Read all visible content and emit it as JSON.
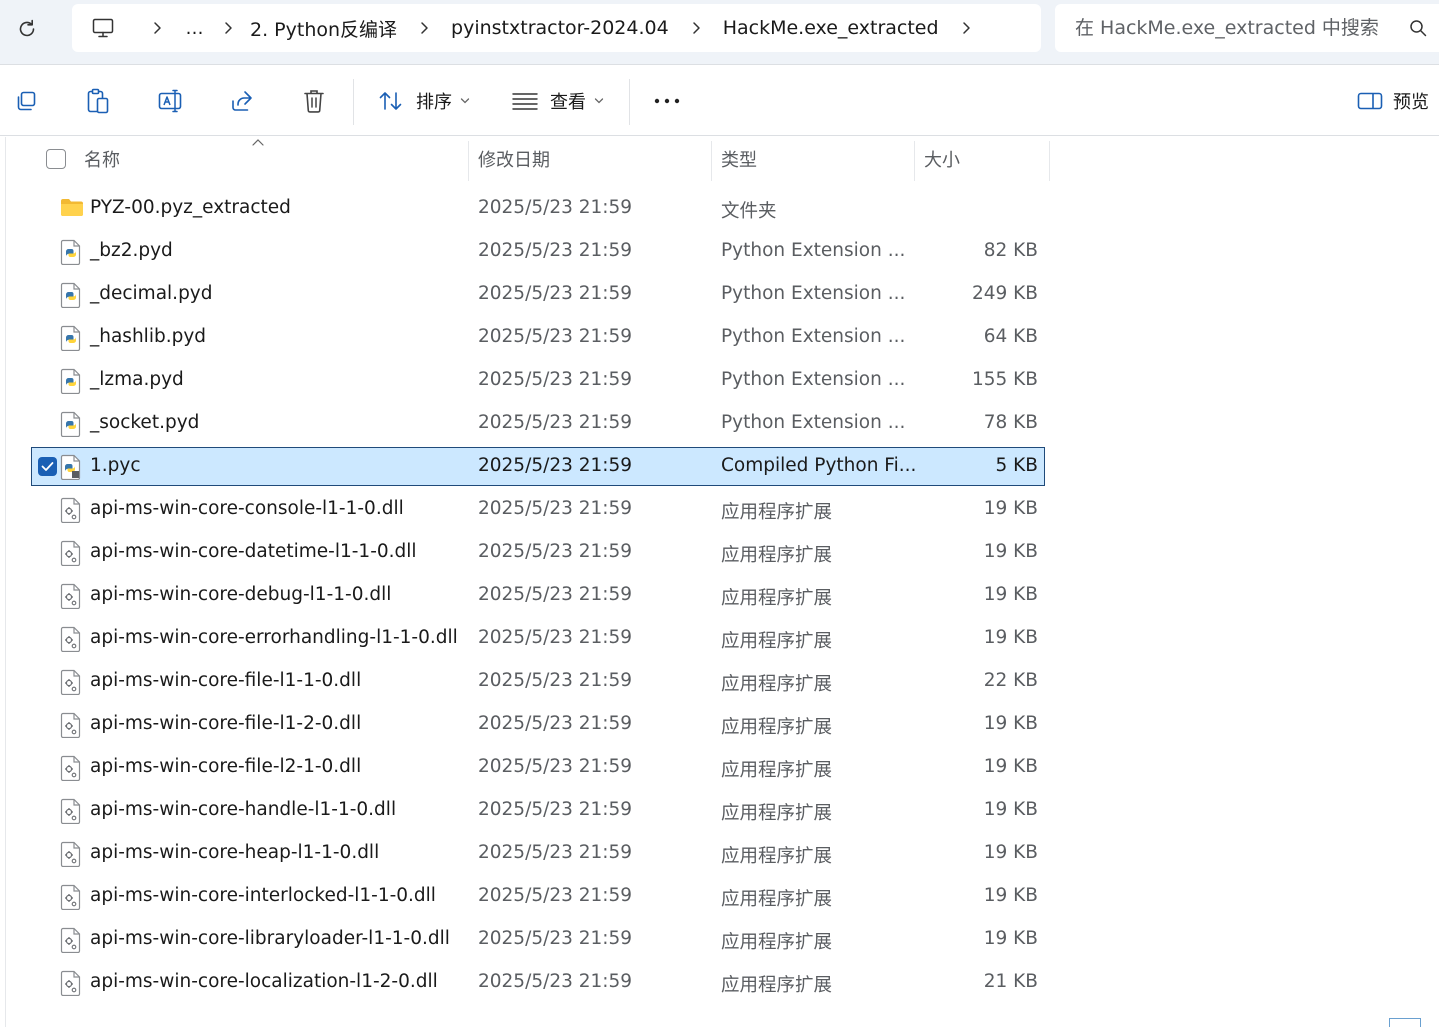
{
  "breadcrumb": {
    "items": [
      "2. Python反编译",
      "pyinstxtractor-2024.04",
      "HackMe.exe_extracted"
    ],
    "overflow": "…"
  },
  "search": {
    "placeholder": "在 HackMe.exe_extracted 中搜索"
  },
  "toolbar": {
    "sort_label": "排序",
    "view_label": "查看",
    "preview_label": "预览"
  },
  "columns": {
    "name": "名称",
    "modified": "修改日期",
    "type": "类型",
    "size": "大小"
  },
  "files": [
    {
      "name": "PYZ-00.pyz_extracted",
      "date": "2025/5/23 21:59",
      "type": "文件夹",
      "size": "",
      "icon": "folder-icon"
    },
    {
      "name": "_bz2.pyd",
      "date": "2025/5/23 21:59",
      "type": "Python Extension ...",
      "size": "82 KB",
      "icon": "python-file-icon"
    },
    {
      "name": "_decimal.pyd",
      "date": "2025/5/23 21:59",
      "type": "Python Extension ...",
      "size": "249 KB",
      "icon": "python-file-icon"
    },
    {
      "name": "_hashlib.pyd",
      "date": "2025/5/23 21:59",
      "type": "Python Extension ...",
      "size": "64 KB",
      "icon": "python-file-icon"
    },
    {
      "name": "_lzma.pyd",
      "date": "2025/5/23 21:59",
      "type": "Python Extension ...",
      "size": "155 KB",
      "icon": "python-file-icon"
    },
    {
      "name": "_socket.pyd",
      "date": "2025/5/23 21:59",
      "type": "Python Extension ...",
      "size": "78 KB",
      "icon": "python-file-icon"
    },
    {
      "name": "1.pyc",
      "date": "2025/5/23 21:59",
      "type": "Compiled Python Fi...",
      "size": "5 KB",
      "icon": "python-compiled-icon",
      "selected": true
    },
    {
      "name": "api-ms-win-core-console-l1-1-0.dll",
      "date": "2025/5/23 21:59",
      "type": "应用程序扩展",
      "size": "19 KB",
      "icon": "dll-file-icon"
    },
    {
      "name": "api-ms-win-core-datetime-l1-1-0.dll",
      "date": "2025/5/23 21:59",
      "type": "应用程序扩展",
      "size": "19 KB",
      "icon": "dll-file-icon"
    },
    {
      "name": "api-ms-win-core-debug-l1-1-0.dll",
      "date": "2025/5/23 21:59",
      "type": "应用程序扩展",
      "size": "19 KB",
      "icon": "dll-file-icon"
    },
    {
      "name": "api-ms-win-core-errorhandling-l1-1-0.dll",
      "date": "2025/5/23 21:59",
      "type": "应用程序扩展",
      "size": "19 KB",
      "icon": "dll-file-icon"
    },
    {
      "name": "api-ms-win-core-file-l1-1-0.dll",
      "date": "2025/5/23 21:59",
      "type": "应用程序扩展",
      "size": "22 KB",
      "icon": "dll-file-icon"
    },
    {
      "name": "api-ms-win-core-file-l1-2-0.dll",
      "date": "2025/5/23 21:59",
      "type": "应用程序扩展",
      "size": "19 KB",
      "icon": "dll-file-icon"
    },
    {
      "name": "api-ms-win-core-file-l2-1-0.dll",
      "date": "2025/5/23 21:59",
      "type": "应用程序扩展",
      "size": "19 KB",
      "icon": "dll-file-icon"
    },
    {
      "name": "api-ms-win-core-handle-l1-1-0.dll",
      "date": "2025/5/23 21:59",
      "type": "应用程序扩展",
      "size": "19 KB",
      "icon": "dll-file-icon"
    },
    {
      "name": "api-ms-win-core-heap-l1-1-0.dll",
      "date": "2025/5/23 21:59",
      "type": "应用程序扩展",
      "size": "19 KB",
      "icon": "dll-file-icon"
    },
    {
      "name": "api-ms-win-core-interlocked-l1-1-0.dll",
      "date": "2025/5/23 21:59",
      "type": "应用程序扩展",
      "size": "19 KB",
      "icon": "dll-file-icon"
    },
    {
      "name": "api-ms-win-core-libraryloader-l1-1-0.dll",
      "date": "2025/5/23 21:59",
      "type": "应用程序扩展",
      "size": "19 KB",
      "icon": "dll-file-icon"
    },
    {
      "name": "api-ms-win-core-localization-l1-2-0.dll",
      "date": "2025/5/23 21:59",
      "type": "应用程序扩展",
      "size": "21 KB",
      "icon": "dll-file-icon"
    }
  ],
  "colors": {
    "selection": "#cce8ff",
    "selection_border": "#1f4a7a",
    "accent": "#1a5fb4",
    "address_bg": "#eff3f8"
  }
}
